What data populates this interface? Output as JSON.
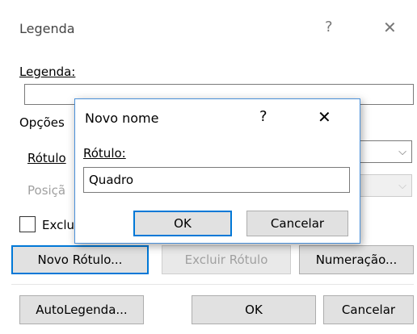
{
  "main_dialog": {
    "title": "Legenda",
    "help_glyph": "?",
    "close_glyph": "✕",
    "caption_label": "Legenda:",
    "caption_value": "",
    "options_label": "Opções",
    "label_row_text": "Rótulo",
    "position_row_text": "Posiçã",
    "exclude_checkbox_text": "Exclu",
    "exclude_checked": false,
    "new_label_button": "Novo Rótulo...",
    "delete_label_button": "Excluir Rótulo",
    "numbering_button": "Numeração...",
    "autocaption_button": "AutoLegenda...",
    "ok_button": "OK",
    "cancel_button": "Cancelar"
  },
  "new_name_dialog": {
    "title": "Novo nome",
    "help_glyph": "?",
    "close_glyph": "✕",
    "label_caption": "Rótulo:",
    "label_value": "Quadro",
    "ok_button": "OK",
    "cancel_button": "Cancelar"
  },
  "colors": {
    "focus_border": "#0078d7",
    "dialog_border": "#4a90d9"
  }
}
